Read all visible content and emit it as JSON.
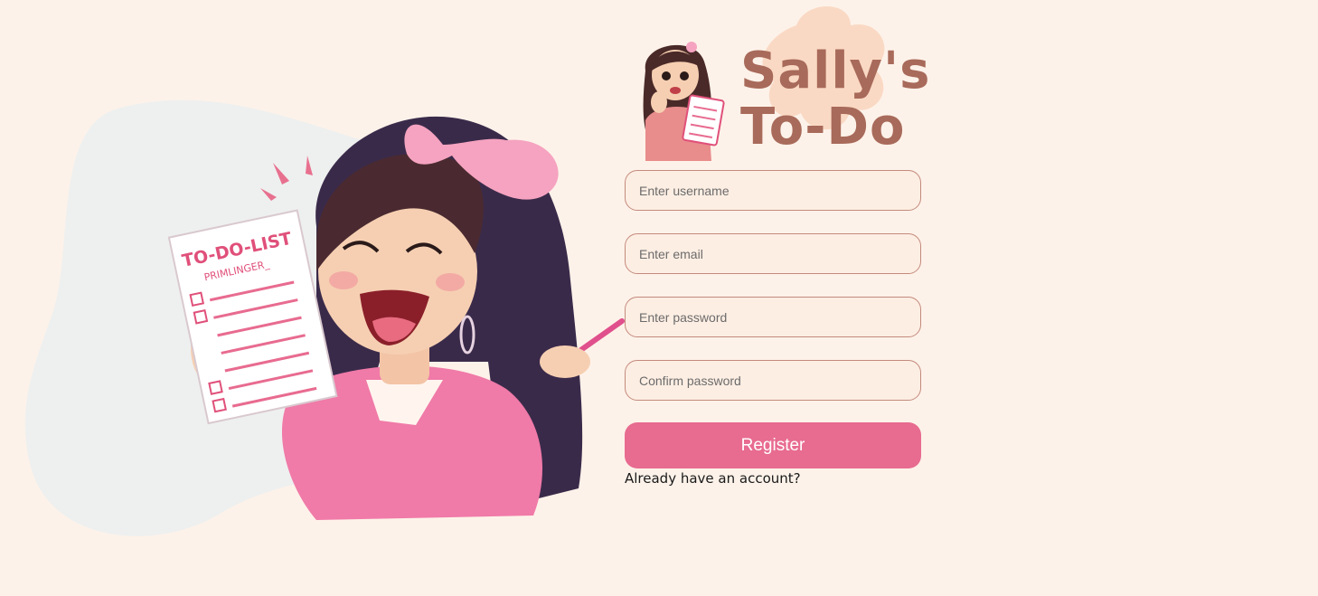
{
  "brand": {
    "title_line1": "Sally's",
    "title_line2": "To-Do"
  },
  "illustration": {
    "list_heading": "TO-DO-LIST",
    "list_subheading": "PRIMLINGER_"
  },
  "form": {
    "username_placeholder": "Enter username",
    "email_placeholder": "Enter email",
    "password_placeholder": "Enter password",
    "confirm_placeholder": "Confirm password",
    "register_label": "Register",
    "login_link_label": "Already have an account?"
  },
  "colors": {
    "background": "#fdf2e9",
    "accent": "#e86b90",
    "brand_text": "#a86a5a",
    "field_border": "#c48a7d",
    "field_background": "#fdeee3"
  }
}
